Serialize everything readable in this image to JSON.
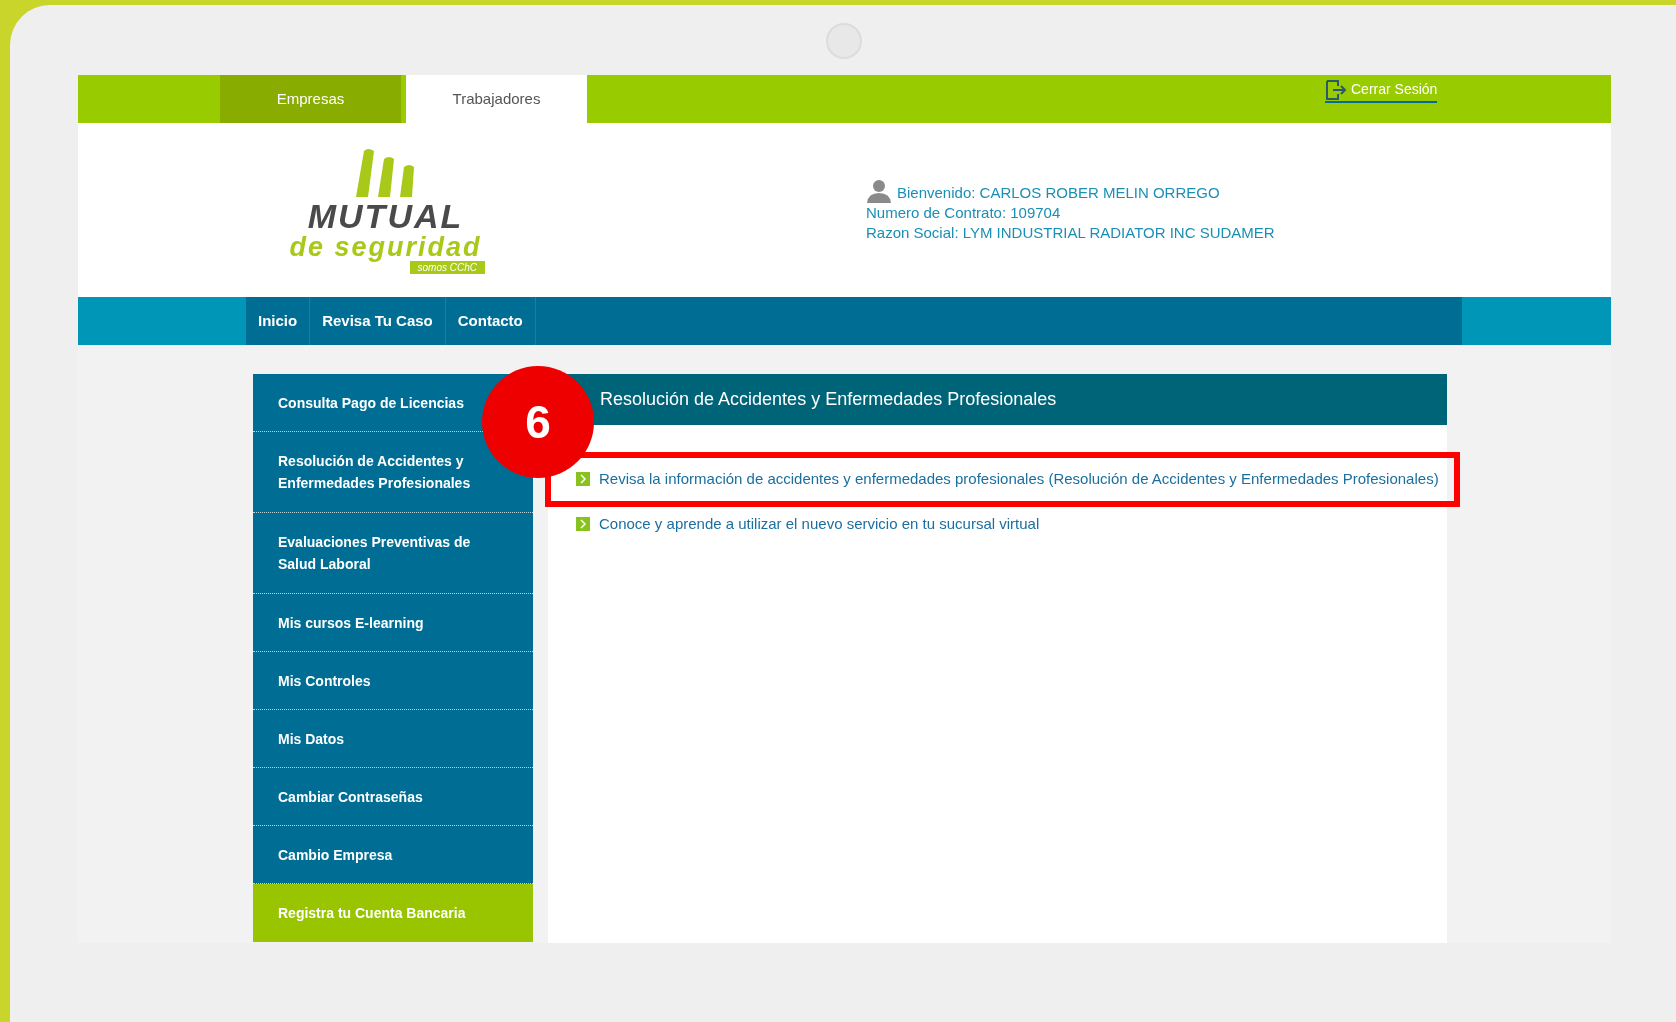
{
  "top_tabs": [
    {
      "label": "Empresas",
      "selected": false
    },
    {
      "label": "Trabajadores",
      "selected": true
    }
  ],
  "logout": {
    "label": "Cerrar Sesión"
  },
  "logo": {
    "name": "MUTUAL",
    "tagline": "de seguridad",
    "badge": "somos CChC"
  },
  "user_info": {
    "welcome": "Bienvenido: CARLOS ROBER MELIN ORREGO",
    "contract": "Numero de Contrato: 109704",
    "company": "Razon Social: LYM INDUSTRIAL RADIATOR INC SUDAMER"
  },
  "nav": [
    "Inicio",
    "Revisa Tu Caso",
    "Contacto"
  ],
  "sidebar": {
    "items": [
      {
        "label": "Consulta Pago de Licencias",
        "highlighted": false
      },
      {
        "label": "Resolución de Accidentes y Enfermedades Profesionales",
        "highlighted": false
      },
      {
        "label": "Evaluaciones Preventivas de Salud Laboral",
        "highlighted": false
      },
      {
        "label": "Mis cursos E-learning",
        "highlighted": false
      },
      {
        "label": "Mis Controles",
        "highlighted": false
      },
      {
        "label": "Mis Datos",
        "highlighted": false
      },
      {
        "label": "Cambiar Contraseñas",
        "highlighted": false
      },
      {
        "label": "Cambio Empresa",
        "highlighted": false
      },
      {
        "label": "Registra tu Cuenta Bancaria",
        "highlighted": true
      }
    ]
  },
  "main": {
    "title": "Resolución de Accidentes y Enfermedades Profesionales",
    "links": [
      {
        "label": "Revisa la información de accidentes y enfermedades profesionales (Resolución de Accidentes y Enfermedades Profesionales)",
        "highlighted": true
      },
      {
        "label": "Conoce y aprende a utilizar el nuevo servicio en tu sucursal virtual",
        "highlighted": false
      }
    ]
  },
  "step_badge": "6"
}
